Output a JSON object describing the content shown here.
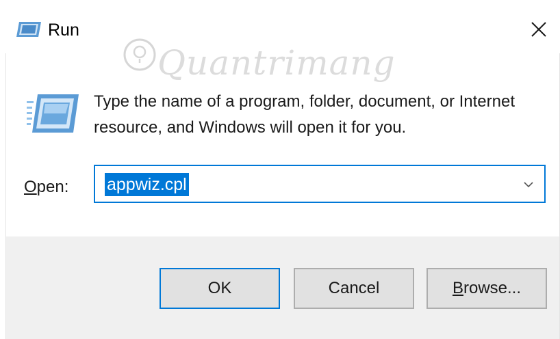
{
  "window": {
    "title": "Run",
    "icon": "run-icon",
    "close_icon": "close-icon"
  },
  "watermark": {
    "text": "Quantrimang"
  },
  "content": {
    "icon": "run-program-icon",
    "description": "Type the name of a program, folder, document, or Internet resource, and Windows will open it for you.",
    "open_label_mnemonic": "O",
    "open_label_rest": "pen:",
    "open_value": "appwiz.cpl",
    "dropdown_icon": "chevron-down-icon"
  },
  "buttons": {
    "ok": "OK",
    "cancel": "Cancel",
    "browse_mnemonic": "B",
    "browse_rest": "rowse..."
  },
  "colors": {
    "accent": "#0078d7",
    "footer_bg": "#f0f0f0",
    "button_bg": "#e1e1e1"
  }
}
